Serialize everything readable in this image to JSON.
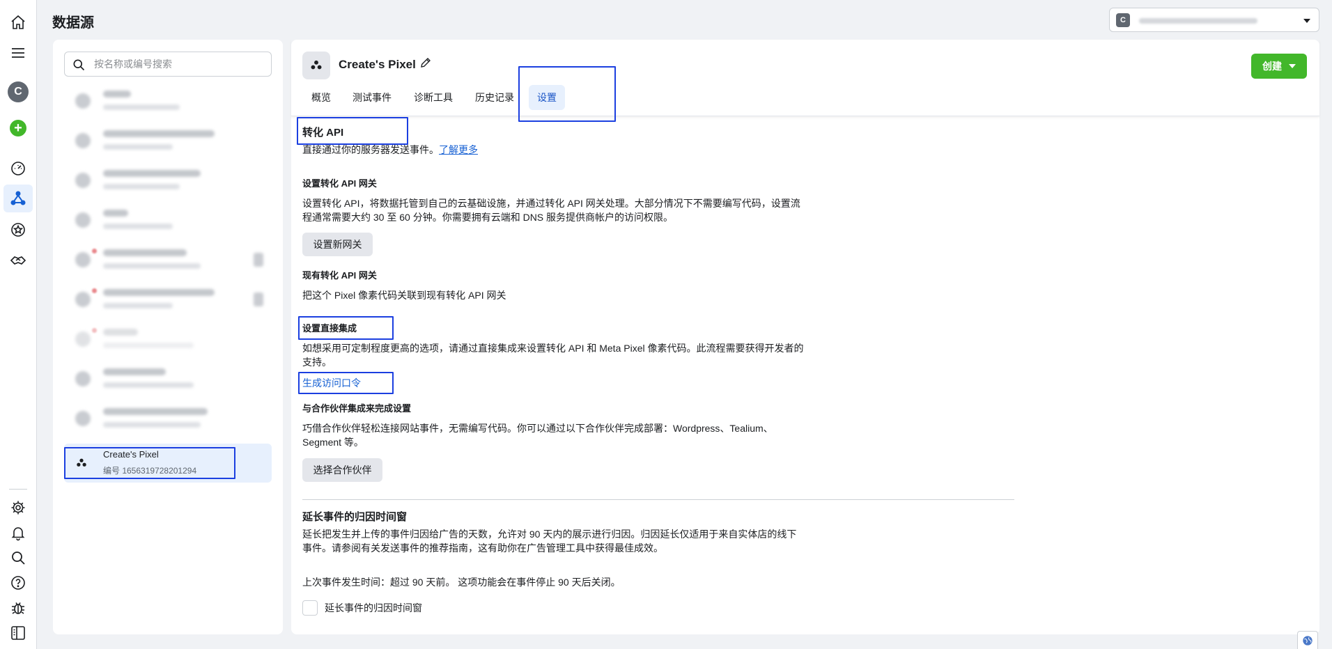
{
  "header": {
    "title": "数据源"
  },
  "account_menu": {
    "avatar_letter": "C"
  },
  "rail": {
    "avatar_letter": "C",
    "icons": [
      "home-icon",
      "menu-icon",
      "avatar",
      "add-icon",
      "gauge-icon",
      "network-icon",
      "star-icon",
      "handshake-icon",
      "gear-icon",
      "bell-icon",
      "search-icon",
      "help-icon",
      "bug-icon",
      "panel-icon"
    ]
  },
  "sidebar": {
    "search_placeholder": "按名称或编号搜索",
    "selected": {
      "name": "Create's Pixel",
      "id_label": "编号 1656319728201294"
    }
  },
  "main": {
    "title": "Create's Pixel",
    "create_button": "创建",
    "tabs": [
      "概览",
      "测试事件",
      "诊断工具",
      "历史记录",
      "设置"
    ],
    "active_tab": "设置",
    "capi": {
      "heading": "转化 API",
      "desc": "直接通过你的服务器发送事件。",
      "learn_more": "了解更多"
    },
    "gateway": {
      "heading": "设置转化 API 网关",
      "desc_line1": "设置转化 API，将数据托管到自己的云基础设施，并通过转化 API 网关处理。大部分情况下不需要编写代码，设置流",
      "desc_line2": "程通常需要大约 30 至 60 分钟。你需要拥有云端和 DNS 服务提供商帐户的访问权限。",
      "button": "设置新网关"
    },
    "existing_gateway": {
      "heading": "现有转化 API 网关",
      "desc": "把这个 Pixel 像素代码关联到现有转化 API 网关"
    },
    "direct": {
      "heading": "设置直接集成",
      "desc_line1": "如想采用可定制程度更高的选项，请通过直接集成来设置转化 API 和 Meta Pixel 像素代码。此流程需要获得开发者的",
      "desc_line2": "支持。",
      "token_link": "生成访问口令"
    },
    "partner": {
      "heading": "与合作伙伴集成来完成设置",
      "desc_line1": "巧借合作伙伴轻松连接网站事件，无需编写代码。你可以通过以下合作伙伴完成部署：Wordpress、Tealium、",
      "desc_line2": "Segment 等。",
      "button": "选择合作伙伴"
    },
    "attribution": {
      "heading": "延长事件的归因时间窗",
      "desc_line1": "延长把发生并上传的事件归因给广告的天数，允许对 90 天内的展示进行归因。归因延长仅适用于来自实体店的线下",
      "desc_line2": "事件。请参阅有关发送事件的推荐指南，这有助你在广告管理工具中获得最佳成效。",
      "last_event": "上次事件发生时间：超过 90 天前。 这项功能会在事件停止 90 天后关闭。",
      "checkbox_label": "延长事件的归因时间窗"
    }
  }
}
